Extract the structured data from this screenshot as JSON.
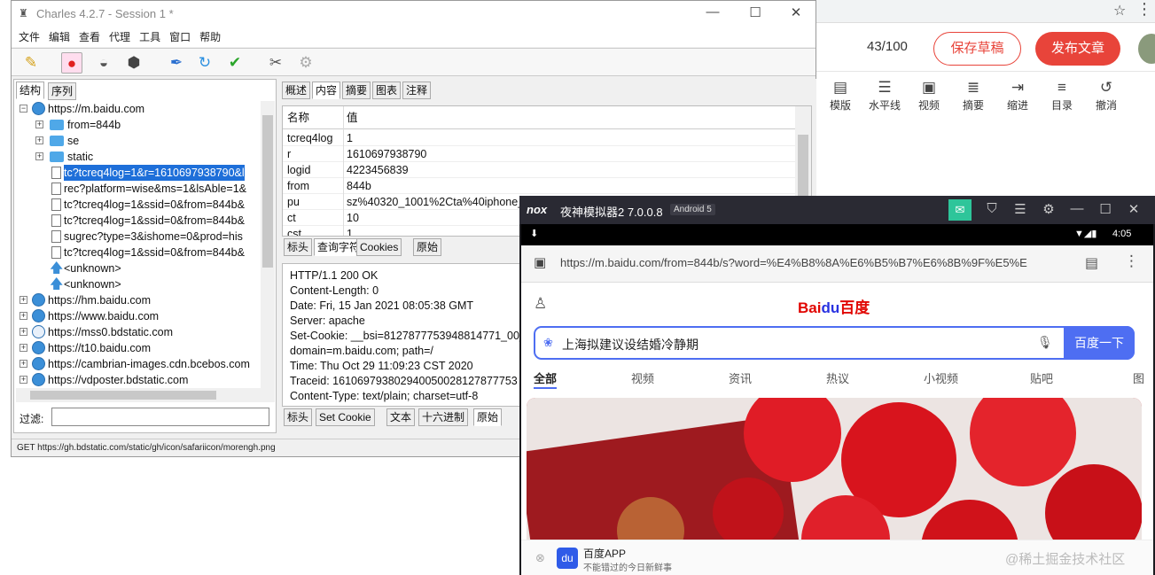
{
  "editor": {
    "word_count": "43/100",
    "save_draft": "保存草稿",
    "publish": "发布文章",
    "tools": [
      {
        "label": "模版",
        "icon": "template-icon",
        "glyph": "▤"
      },
      {
        "label": "水平线",
        "icon": "horizontal-rule-icon",
        "glyph": "☰"
      },
      {
        "label": "视频",
        "icon": "video-icon",
        "glyph": "▣"
      },
      {
        "label": "摘要",
        "icon": "summary-icon",
        "glyph": "≣"
      },
      {
        "label": "缩进",
        "icon": "indent-icon",
        "glyph": "⇥"
      },
      {
        "label": "目录",
        "icon": "toc-icon",
        "glyph": "≡"
      },
      {
        "label": "撤消",
        "icon": "undo-icon",
        "glyph": "↺"
      }
    ]
  },
  "charles": {
    "title": "Charles 4.2.7 - Session 1 *",
    "menu": [
      "文件",
      "编辑",
      "查看",
      "代理",
      "工具",
      "窗口",
      "帮助"
    ],
    "left_tabs": [
      "结构",
      "序列"
    ],
    "tree": [
      {
        "depth": 0,
        "type": "globe",
        "expand": "⊟",
        "label": "https://m.baidu.com"
      },
      {
        "depth": 1,
        "type": "folder",
        "expand": "⊞",
        "label": "from=844b"
      },
      {
        "depth": 1,
        "type": "folder",
        "expand": "⊞",
        "label": "se"
      },
      {
        "depth": 1,
        "type": "folder",
        "expand": "⊞",
        "label": "static"
      },
      {
        "depth": 2,
        "type": "doc",
        "expand": "",
        "label": "tc?tcreq4log=1&r=1610697938790&l",
        "selected": true
      },
      {
        "depth": 2,
        "type": "doc",
        "expand": "",
        "label": "rec?platform=wise&ms=1&lsAble=1&"
      },
      {
        "depth": 2,
        "type": "doc",
        "expand": "",
        "label": "tc?tcreq4log=1&ssid=0&from=844b&"
      },
      {
        "depth": 2,
        "type": "doc",
        "expand": "",
        "label": "tc?tcreq4log=1&ssid=0&from=844b&"
      },
      {
        "depth": 2,
        "type": "doc",
        "expand": "",
        "label": "sugrec?type=3&ishome=0&prod=his"
      },
      {
        "depth": 2,
        "type": "doc",
        "expand": "",
        "label": "tc?tcreq4log=1&ssid=0&from=844b&"
      },
      {
        "depth": 2,
        "type": "arrow",
        "expand": "",
        "label": "<unknown>"
      },
      {
        "depth": 2,
        "type": "arrow",
        "expand": "",
        "label": "<unknown>"
      },
      {
        "depth": 0,
        "type": "globe",
        "expand": "⊞",
        "label": "https://hm.baidu.com"
      },
      {
        "depth": 0,
        "type": "globe",
        "expand": "⊞",
        "label": "https://www.baidu.com"
      },
      {
        "depth": 0,
        "type": "bolt",
        "expand": "⊞",
        "label": "https://mss0.bdstatic.com"
      },
      {
        "depth": 0,
        "type": "globe",
        "expand": "⊞",
        "label": "https://t10.baidu.com"
      },
      {
        "depth": 0,
        "type": "globe",
        "expand": "⊞",
        "label": "https://cambrian-images.cdn.bcebos.com"
      },
      {
        "depth": 0,
        "type": "globe",
        "expand": "⊞",
        "label": "https://vdposter.bdstatic.com"
      }
    ],
    "filter_label": "过滤:",
    "right_tabs": [
      "概述",
      "内容",
      "摘要",
      "图表",
      "注释"
    ],
    "kv_header": {
      "name": "名称",
      "value": "值"
    },
    "kv_rows": [
      {
        "k": "tcreq4log",
        "v": "1"
      },
      {
        "k": "r",
        "v": "1610697938790"
      },
      {
        "k": "logid",
        "v": "4223456839"
      },
      {
        "k": "from",
        "v": "844b"
      },
      {
        "k": "pu",
        "v": "sz%40320_1001%2Cta%40iphone_"
      },
      {
        "k": "ct",
        "v": "10"
      },
      {
        "k": "cst",
        "v": "1"
      }
    ],
    "request_tabs": [
      "标头",
      "查询字符串",
      "Cookies",
      "原始"
    ],
    "response_lines": [
      "HTTP/1.1 200 OK",
      "Content-Length: 0",
      "Date: Fri, 15 Jan 2021 08:05:38 GMT",
      "Server: apache",
      "Set-Cookie: __bsi=8127877753948814771_00_",
      "domain=m.baidu.com; path=/",
      "Time: Thu Oct 29 11:09:23 CST 2020",
      "Traceid: 161069793802940050028127877753",
      "Content-Type: text/plain; charset=utf-8"
    ],
    "response_tabs": [
      "标头",
      "Set Cookie",
      "文本",
      "十六进制",
      "原始"
    ],
    "status": "GET https://gh.bdstatic.com/static/gh/icon/safariicon/morengh.png"
  },
  "nox": {
    "logo": "nox",
    "name": "夜神模拟器2 7.0.0.8",
    "android": "Android 5",
    "time": "4:05",
    "url": "https://m.baidu.com/from=844b/s?word=%E4%B8%8A%E6%B5%B7%E6%8B%9F%E5%E",
    "search_text": "上海拟建议设结婚冷静期",
    "search_btn": "百度一下",
    "nav_tabs": [
      "全部",
      "视频",
      "资讯",
      "热议",
      "小视频",
      "贴吧",
      "图"
    ],
    "banner_title": "百度APP",
    "banner_sub": "不能错过的今日新鲜事",
    "watermark": "@稀土掘金技术社区",
    "colors": {
      "brand": "#e8443a",
      "baidu_blue": "#4e6ef2",
      "nox_green": "#2ec59a"
    }
  }
}
